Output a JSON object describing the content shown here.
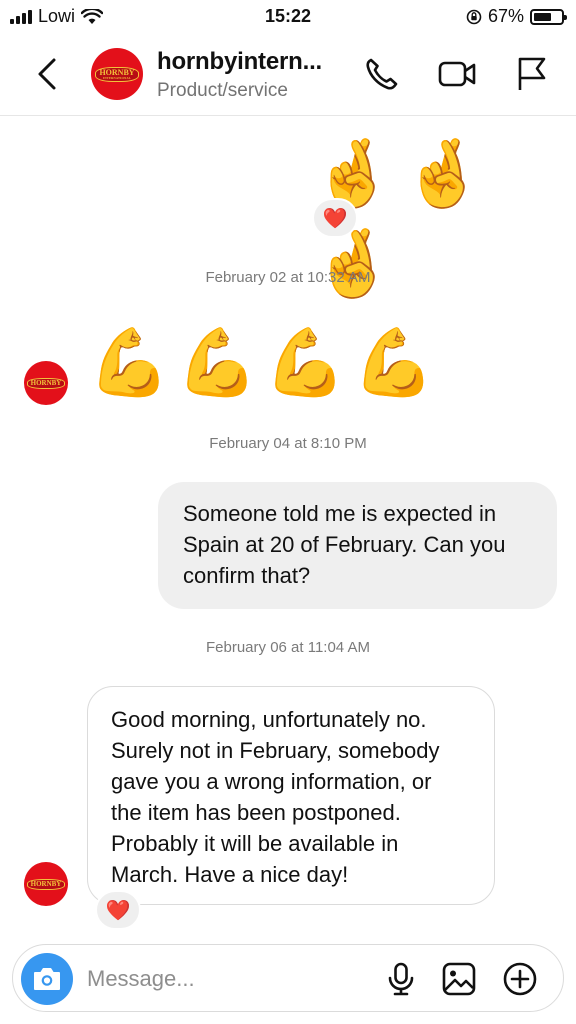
{
  "status_bar": {
    "carrier": "Lowi",
    "time": "15:22",
    "battery_percent": "67%",
    "battery_level": 0.67
  },
  "header": {
    "name": "hornbyintern...",
    "category": "Product/service",
    "avatar_text": "HORNBY",
    "avatar_subtext": "INTERNATIONAL",
    "icons": [
      "back-chevron",
      "phone",
      "video-camera",
      "flag"
    ]
  },
  "messages": [
    {
      "type": "emoji",
      "direction": "outgoing",
      "content": "🤞🤞🤞",
      "reaction": "❤️"
    },
    {
      "type": "timestamp",
      "text": "February 02 at 10:32 AM"
    },
    {
      "type": "emoji",
      "direction": "incoming",
      "content": "💪💪💪💪"
    },
    {
      "type": "timestamp",
      "text": "February 04 at 8:10 PM"
    },
    {
      "type": "text",
      "direction": "outgoing",
      "lines": [
        "Someone told me is expected in",
        "Spain at 20 of February. Can you",
        "confirm that?"
      ]
    },
    {
      "type": "timestamp",
      "text": "February 06 at 11:04 AM"
    },
    {
      "type": "text",
      "direction": "incoming",
      "lines": [
        "Good morning, unfortunately no.",
        "Surely not in February, somebody",
        "gave you a wrong information, or",
        "the item has been postponed.",
        "Probably it will be available in",
        "March. Have a nice day!"
      ],
      "reaction": "❤️"
    }
  ],
  "composer": {
    "placeholder": "Message...",
    "icons": [
      "camera",
      "microphone",
      "gallery",
      "add"
    ]
  },
  "colors": {
    "accent_blue": "#3797f0",
    "avatar_red": "#e3101a",
    "heart_red": "#e8262d",
    "outgoing_bubble": "#efefef",
    "timestamp_gray": "#7a7a7a"
  }
}
